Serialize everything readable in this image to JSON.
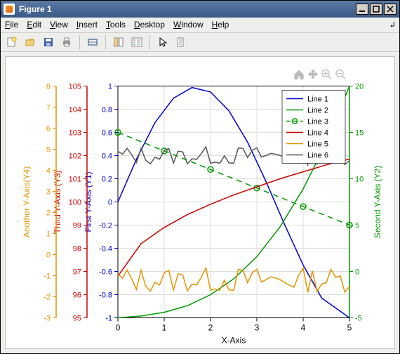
{
  "window": {
    "title": "Figure 1"
  },
  "menu": {
    "file": "File",
    "edit": "Edit",
    "view": "View",
    "insert": "Insert",
    "tools": "Tools",
    "desktop": "Desktop",
    "window": "Window",
    "help": "Help"
  },
  "toolbar_icons": {
    "new": "new-figure-icon",
    "open": "open-icon",
    "save": "save-icon",
    "print": "print-icon",
    "link": "link-icon",
    "datacursor": "datacursor-icon",
    "colorbar": "colorbar-icon",
    "legend": "legend-icon",
    "pointer": "pointer-icon",
    "insert": "insert-icon"
  },
  "chart_tools": {
    "home": "home",
    "pan": "pan",
    "zoomin": "zoom-in",
    "zoomout": "zoom-out"
  },
  "chart_data": {
    "type": "line",
    "xlabel": "X-Axis",
    "x": [
      0,
      0.5,
      1,
      1.5,
      2,
      2.5,
      3,
      3.5,
      4,
      4.5,
      5
    ],
    "axes": [
      {
        "id": "y1",
        "label": "First Y-Axis (Y1)",
        "color": "#0000cc",
        "range": [
          -1,
          1
        ],
        "ticks": [
          -1,
          -0.8,
          -0.6,
          -0.4,
          -0.2,
          0,
          0.2,
          0.4,
          0.6,
          0.8,
          1
        ],
        "side": "left",
        "order": 0
      },
      {
        "id": "y2",
        "label": "Second Y-Axis (Y2)",
        "color": "#009900",
        "range": [
          -5,
          20
        ],
        "ticks": [
          -5,
          0,
          5,
          10,
          15,
          20
        ],
        "side": "right",
        "order": 0
      },
      {
        "id": "y3",
        "label": "Third Y-Axis (Y3)",
        "color": "#cc0000",
        "range": [
          95,
          105
        ],
        "ticks": [
          95,
          96,
          97,
          98,
          99,
          100,
          101,
          102,
          103,
          104,
          105
        ],
        "side": "left",
        "order": 1
      },
      {
        "id": "y4",
        "label": "Another Y-Axis(Y4)",
        "color": "#e59400",
        "range": [
          -3,
          8
        ],
        "ticks": [
          -3,
          -2,
          -1,
          0,
          1,
          2,
          3,
          4,
          5,
          6,
          7,
          8
        ],
        "side": "left",
        "order": 2
      }
    ],
    "xaxis": {
      "range": [
        0,
        5
      ],
      "ticks": [
        0,
        1,
        2,
        3,
        4,
        5
      ]
    },
    "series": [
      {
        "name": "Line 1",
        "axis": "y1",
        "color": "#0000cc",
        "style": "solid",
        "marker": false,
        "y": [
          0,
          0.368,
          0.684,
          0.895,
          0.987,
          0.949,
          0.785,
          0.516,
          0.174,
          -0.196,
          -0.544,
          -0.829,
          -1
        ],
        "x_dense": [
          0,
          0.4,
          0.8,
          1.2,
          1.6,
          2.0,
          2.4,
          2.8,
          3.2,
          3.6,
          4.0,
          4.4,
          5.0
        ]
      },
      {
        "name": "Line 2",
        "axis": "y2",
        "color": "#009900",
        "style": "solid",
        "marker": false,
        "y": [
          -5,
          -4.8,
          -4.4,
          -3.7,
          -2.5,
          -0.8,
          1.6,
          4.8,
          8.9,
          13.9,
          20
        ],
        "x_dense": [
          0,
          0.5,
          1,
          1.5,
          2,
          2.5,
          3,
          3.5,
          4,
          4.5,
          5
        ]
      },
      {
        "name": "Line 3",
        "axis": "y2",
        "color": "#009900",
        "style": "dashed",
        "marker": true,
        "y": [
          15,
          13,
          11,
          9,
          7,
          5
        ],
        "x_dense": [
          0,
          1,
          2,
          3,
          4,
          5
        ]
      },
      {
        "name": "Line 4",
        "axis": "y3",
        "color": "#cc0000",
        "style": "solid",
        "marker": false,
        "y": [
          96.8,
          98.2,
          98.9,
          99.45,
          99.9,
          100.3,
          100.65,
          101.0,
          101.3,
          101.6,
          101.85
        ],
        "x_dense": [
          0,
          0.5,
          1,
          1.5,
          2,
          2.5,
          3,
          3.5,
          4,
          4.5,
          5
        ]
      },
      {
        "name": "Line 5",
        "axis": "y4",
        "color": "#e59400",
        "style": "solid",
        "marker": false,
        "noise": true,
        "base": -1.2,
        "amp": 0.6
      },
      {
        "name": "Line 6",
        "axis": "y1",
        "color": "#555555",
        "style": "solid",
        "marker": false,
        "noise": true,
        "base": 0.4,
        "amp": 0.08,
        "axis_override": "y1"
      }
    ],
    "legend": {
      "entries": [
        "Line 1",
        "Line 2",
        "Line 3",
        "Line 4",
        "Line 5",
        "Line 6"
      ],
      "position": "upper-right-inside"
    }
  }
}
